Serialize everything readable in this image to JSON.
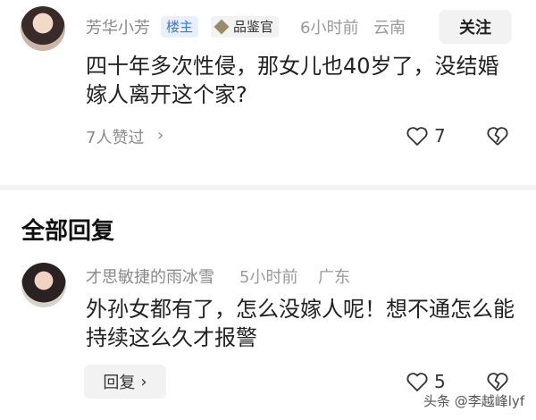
{
  "post": {
    "author": "芳华小芳",
    "badge_host": "楼主",
    "badge_taster": "品鉴官",
    "time": "6小时前",
    "location": "云南",
    "follow_label": "关注",
    "text": "四十年多次性侵，那女儿也40岁了，没结婚嫁人离开这个家?",
    "likers": "7人赞过",
    "likers_chevron": "›",
    "like_count": "7"
  },
  "replies_section": {
    "title": "全部回复"
  },
  "reply": {
    "author": "才思敏捷的雨冰雪",
    "time": "5小时前",
    "location": "广东",
    "text": "外孙女都有了，怎么没嫁人呢！想不通怎么能持续这么久才报警",
    "reply_label": "回复",
    "reply_chevron": "›",
    "like_count": "5"
  },
  "watermark": "头条 @李越峰lyf",
  "icons": {
    "like": "heart-outline-icon",
    "dislike": "broken-heart-icon",
    "badge": "diamond-icon"
  }
}
